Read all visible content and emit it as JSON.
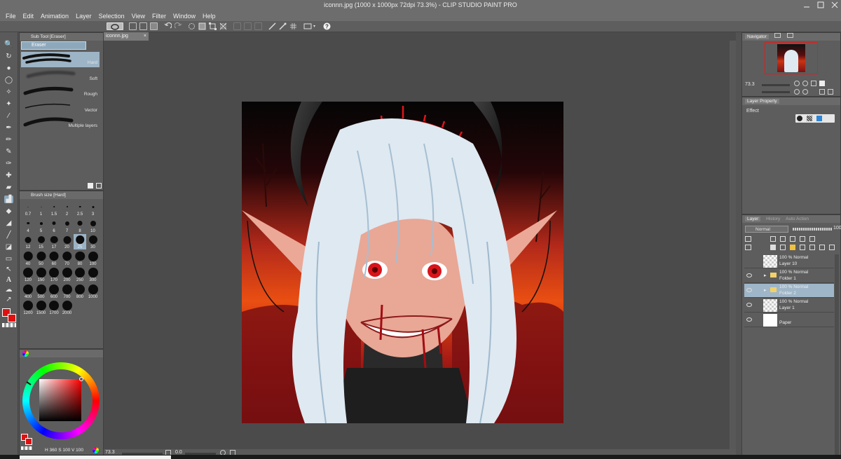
{
  "window": {
    "title": "iconnn.jpg (1000 x 1000px 72dpi 73.3%)  - CLIP STUDIO PAINT PRO"
  },
  "menu": [
    "File",
    "Edit",
    "Animation",
    "Layer",
    "Selection",
    "View",
    "Filter",
    "Window",
    "Help"
  ],
  "subtool": {
    "header": "Sub Tool [Eraser]",
    "group": "Eraser",
    "brushes": [
      "Hard",
      "Soft",
      "Rough",
      "Vector",
      "Multiple layers"
    ],
    "selected_index": 0
  },
  "brush_size": {
    "header": "Brush size [Hard]",
    "sizes": [
      "0.7",
      "1",
      "1.5",
      "2",
      "2.5",
      "3",
      "4",
      "5",
      "6",
      "7",
      "8",
      "10",
      "12",
      "15",
      "17",
      "20",
      "25",
      "30",
      "40",
      "50",
      "60",
      "70",
      "80",
      "100",
      "120",
      "150",
      "170",
      "200",
      "250",
      "300",
      "400",
      "500",
      "600",
      "700",
      "800",
      "1000",
      "1200",
      "1500",
      "1700",
      "2000"
    ]
  },
  "color": {
    "main": "#e01010",
    "h": "360",
    "s": "100",
    "v": "100",
    "h_label": "H",
    "s_label": "S",
    "v_label": "V"
  },
  "canvas": {
    "tab": "iconnn.jpg",
    "zoom": "73.3",
    "rotation": "0.0"
  },
  "navigator": {
    "header": "Navigator",
    "zoom": "73.3"
  },
  "layer_property": {
    "header": "Layer Property",
    "effect_label": "Effect"
  },
  "layers_panel": {
    "tab_layer": "Layer",
    "tab_history": "History",
    "tab_auto": "Auto Action",
    "blend_mode": "Normal",
    "opacity": "100",
    "layers": [
      {
        "mode": "100 % Normal",
        "name": "Layer 10",
        "type": "raster",
        "visible": false,
        "selected": false
      },
      {
        "mode": "100 % Normal",
        "name": "Folder 1",
        "type": "folder",
        "visible": true,
        "selected": false
      },
      {
        "mode": "100 % Normal",
        "name": "Folder 2",
        "type": "folder",
        "visible": true,
        "selected": true
      },
      {
        "mode": "100 % Normal",
        "name": "Layer 1",
        "type": "raster",
        "visible": true,
        "selected": false
      },
      {
        "mode": "",
        "name": "Paper",
        "type": "paper",
        "visible": true,
        "selected": false
      }
    ]
  },
  "icons": {
    "tool_strip": [
      "zoom-icon",
      "move-icon",
      "operation-icon",
      "lasso-icon",
      "magic-wand-icon",
      "eyedropper-icon",
      "pen-icon",
      "pencil-icon",
      "brush-icon",
      "airbrush-icon",
      "decoration-icon",
      "eraser-icon",
      "blend-icon",
      "fill-icon",
      "gradient-icon",
      "figure-icon",
      "frame-icon",
      "ruler-icon",
      "text-icon",
      "balloon-icon",
      "correct-line-icon"
    ]
  }
}
